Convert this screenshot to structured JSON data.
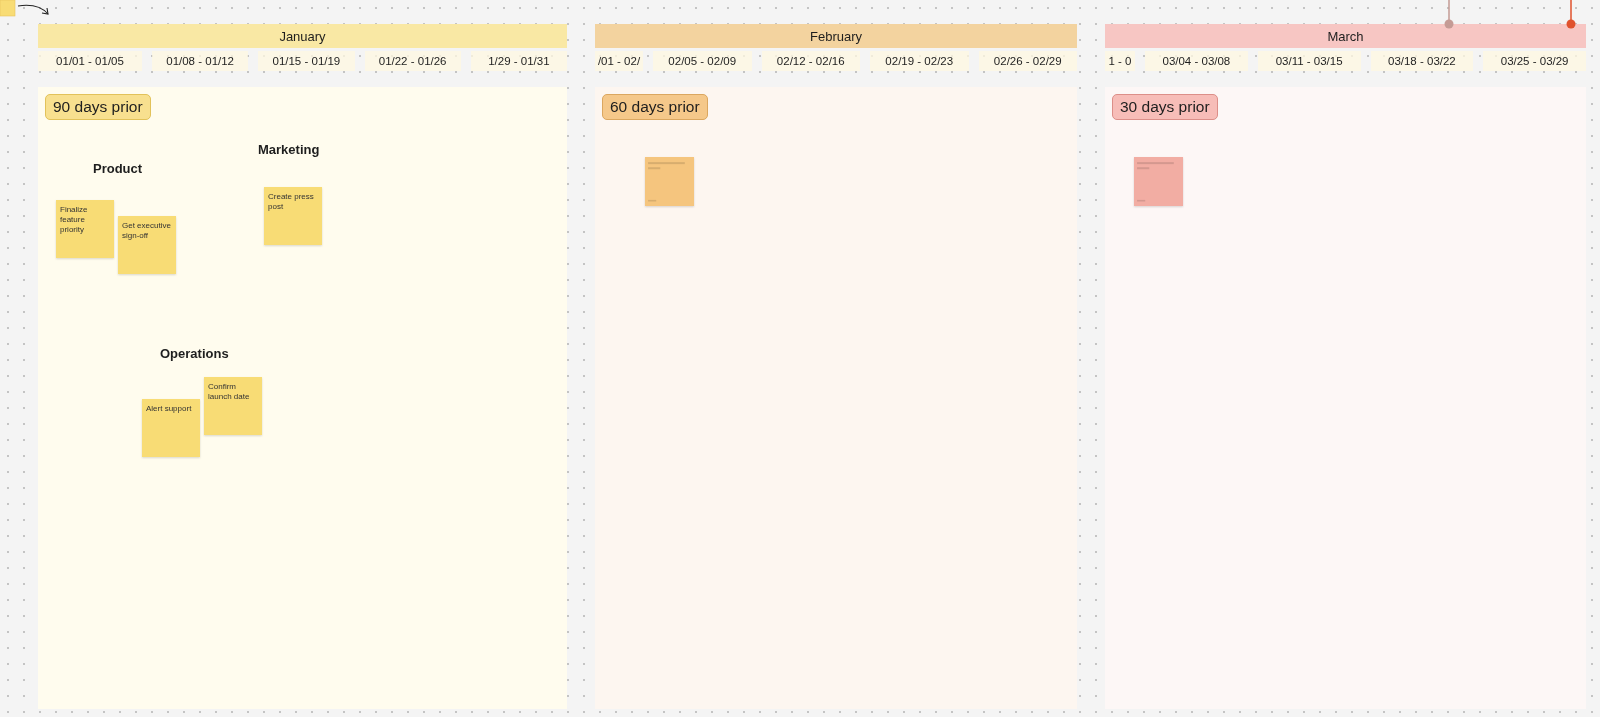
{
  "months": [
    {
      "name": "January",
      "color": "#f9e8a4",
      "weeks": [
        "01/01 - 01/05",
        "01/08 - 01/12",
        "01/15 - 01/19",
        "01/22 - 01/26",
        "1/29 - 01/31"
      ],
      "badge": "90 days prior",
      "groups": [
        {
          "title": "Product",
          "notes": [
            {
              "kind": "sticky",
              "text": "Finalize feature priority"
            },
            {
              "kind": "sticky",
              "text": "Get executive sign-off"
            }
          ]
        },
        {
          "title": "Marketing",
          "notes": [
            {
              "kind": "sticky",
              "text": "Create press post"
            }
          ]
        },
        {
          "title": "Operations",
          "notes": [
            {
              "kind": "sticky",
              "text": "Confirm launch date"
            },
            {
              "kind": "sticky",
              "text": "Alert support"
            }
          ]
        }
      ]
    },
    {
      "name": "February",
      "color": "#f3d39f",
      "weeks": [
        "/01 - 02/",
        "02/05 - 02/09",
        "02/12 - 02/16",
        "02/19 - 02/23",
        "02/26 - 02/29"
      ],
      "badge": "60 days prior",
      "groups": [
        {
          "notes": [
            {
              "kind": "blurred"
            }
          ]
        }
      ]
    },
    {
      "name": "March",
      "color": "#f7c6c3",
      "weeks": [
        "1 - 0",
        "03/04 - 03/08",
        "03/11 - 03/15",
        "03/18 - 03/22",
        "03/25 - 03/29"
      ],
      "badge": "30 days prior",
      "groups": [
        {
          "notes": [
            {
              "kind": "blurred"
            }
          ]
        }
      ]
    }
  ]
}
